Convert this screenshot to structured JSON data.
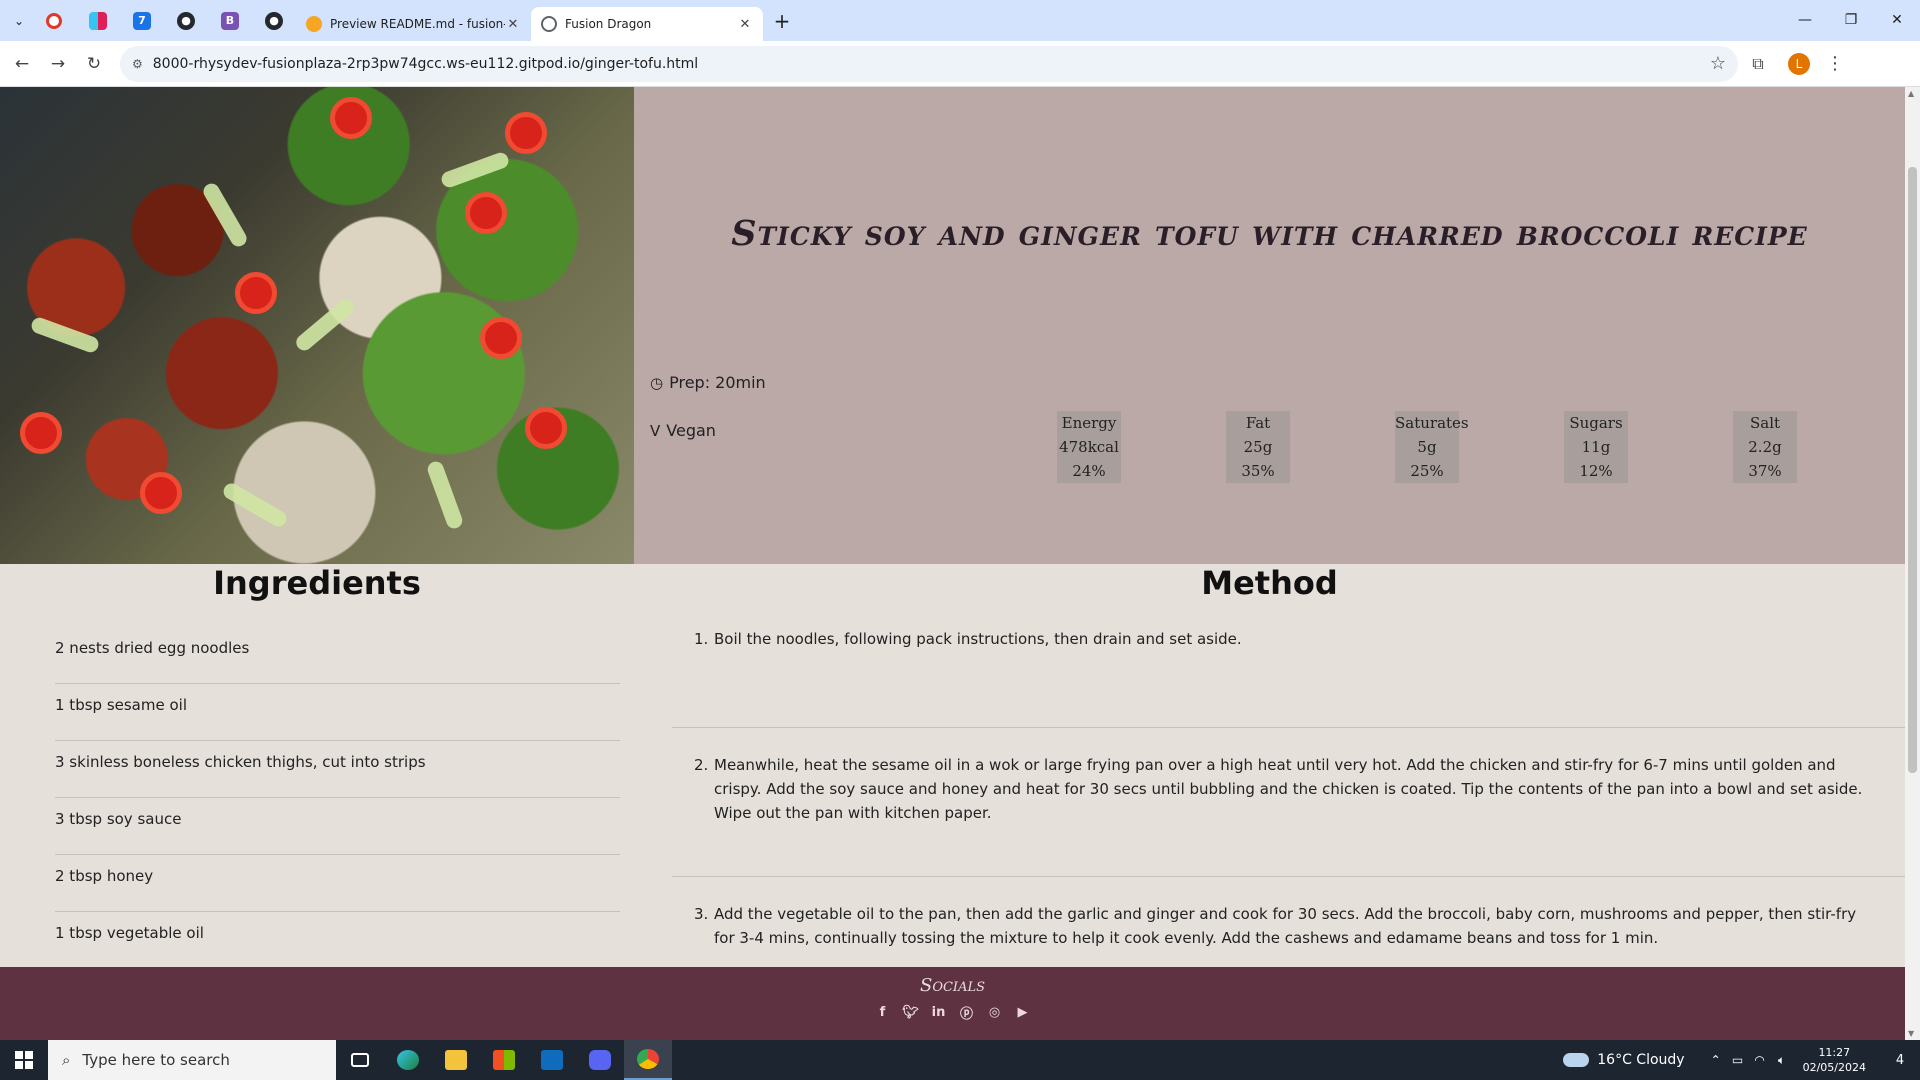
{
  "browser": {
    "tabs": [
      {
        "title": "Preview README.md - fusion-p",
        "close": "✕"
      },
      {
        "title": "Fusion Dragon",
        "close": "✕"
      }
    ],
    "new_tab": "+",
    "url": "8000-rhysydev-fusionplaza-2rp3pw74gcc.ws-eu112.gitpod.io/ginger-tofu.html",
    "profile_initial": "L"
  },
  "recipe": {
    "title": "Sticky soy and ginger tofu with charred broccoli recipe",
    "prep": "Prep: 20min",
    "diet": "Vegan",
    "nutrition": [
      {
        "label": "Energy",
        "amount": "478kcal",
        "percent": "24%"
      },
      {
        "label": "Fat",
        "amount": "25g",
        "percent": "35%"
      },
      {
        "label": "Saturates",
        "amount": "5g",
        "percent": "25%"
      },
      {
        "label": "Sugars",
        "amount": "11g",
        "percent": "12%"
      },
      {
        "label": "Salt",
        "amount": "2.2g",
        "percent": "37%"
      }
    ],
    "ingredients_title": "Ingredients",
    "ingredients": [
      "2 nests dried egg noodles",
      "1 tbsp sesame oil",
      "3 skinless boneless chicken thighs, cut into strips",
      "3 tbsp soy sauce",
      "2 tbsp honey",
      "1 tbsp vegetable oil"
    ],
    "method_title": "Method",
    "steps": [
      {
        "num": "1.",
        "text": "Boil the noodles, following pack instructions, then drain and set aside."
      },
      {
        "num": "2.",
        "text": "Meanwhile, heat the sesame oil in a wok or large frying pan over a high heat until very hot. Add the chicken and stir-fry for 6-7 mins until golden and crispy. Add the soy sauce and honey and heat for 30 secs until bubbling and the chicken is coated. Tip the contents of the pan into a bowl and set aside. Wipe out the pan with kitchen paper."
      },
      {
        "num": "3.",
        "text": "Add the vegetable oil to the pan, then add the garlic and ginger and cook for 30 secs. Add the broccoli, baby corn, mushrooms and pepper, then stir-fry for 3-4 mins, continually tossing the mixture to help it cook evenly. Add the cashews and edamame beans and toss for 1 min."
      }
    ]
  },
  "footer": {
    "socials_title": "Socials",
    "icons": [
      "facebook-icon",
      "twitter-icon",
      "linkedin-icon",
      "pinterest-icon",
      "instagram-icon",
      "youtube-icon"
    ]
  },
  "taskbar": {
    "search_placeholder": "Type here to search",
    "weather": "16°C  Cloudy",
    "time": "11:27",
    "date": "02/05/2024",
    "notifications": "4"
  },
  "colors": {
    "hero_bg": "#bba9a7",
    "page_bg": "#e6e0db",
    "footer_bg": "#5e3240",
    "tabstrip_bg": "#d3e3fd"
  }
}
